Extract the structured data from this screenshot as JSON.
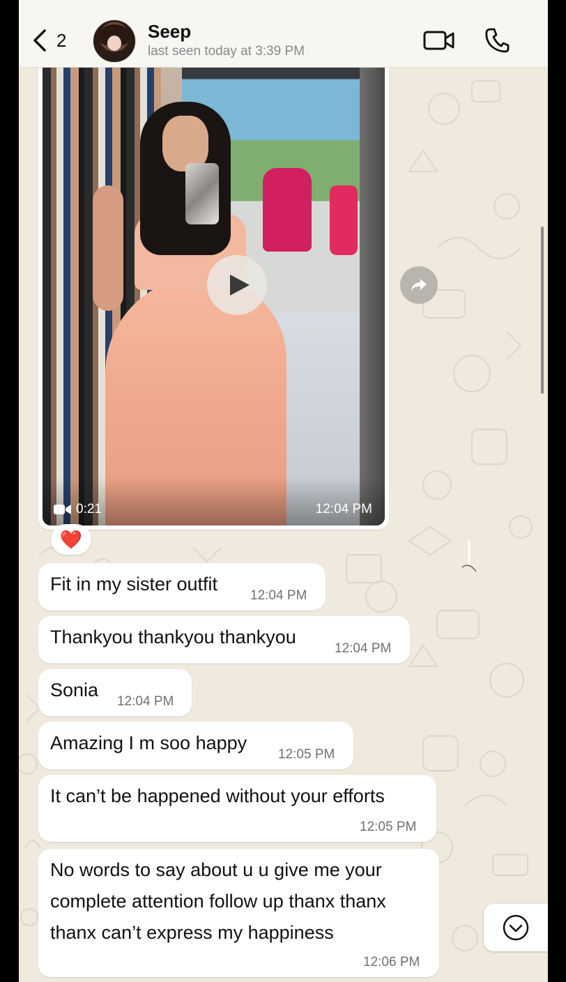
{
  "header": {
    "back_count": "2",
    "contact_name": "Seep",
    "status": "last seen today at 3:39 PM",
    "icons": [
      "back-chevron-icon",
      "video-call-icon",
      "phone-call-icon"
    ]
  },
  "video_message": {
    "duration": "0:21",
    "time": "12:04 PM",
    "reaction": "❤️"
  },
  "messages": [
    {
      "text": "Fit in my sister outfit",
      "time": "12:04 PM"
    },
    {
      "text": "Thankyou thankyou thankyou",
      "time": "12:04 PM"
    },
    {
      "text": "Sonia",
      "time": "12:04 PM"
    },
    {
      "text": "Amazing I m soo happy",
      "time": "12:05 PM"
    },
    {
      "text": "It can’t be happened without your efforts",
      "time": "12:05 PM"
    },
    {
      "lines": [
        "No words to say about u u give me your",
        "complete attention follow up thanx thanx",
        "thanx can’t express my happiness"
      ],
      "time": "12:06 PM"
    }
  ],
  "colors": {
    "wallpaper": "#efe9de",
    "bubble": "#ffffff",
    "header": "#f7f6f3",
    "timestamp": "#707070"
  }
}
